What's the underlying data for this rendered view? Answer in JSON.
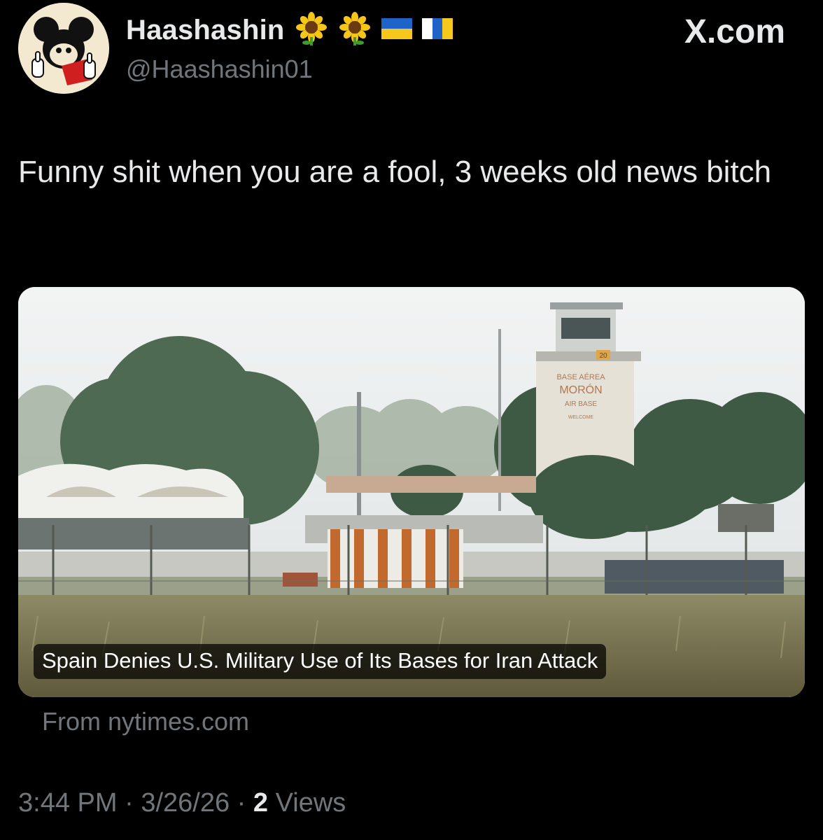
{
  "author": {
    "display_name": "Haashashin",
    "handle": "@Haashashin01",
    "badges": [
      "sunflower-emoji",
      "sunflower-emoji",
      "ukraine-flag",
      "canary-islands-flag"
    ]
  },
  "site_label": "X.com",
  "tweet": {
    "text": "Funny shit when you are a fool, 3 weeks old news bitch"
  },
  "link_card": {
    "headline": "Spain Denies U.S. Military Use of Its Bases for Iran Attack",
    "source": "From nytimes.com",
    "image_text": {
      "line1": "BASE AÉREA",
      "line2": "MORÓN",
      "line3": "AIR BASE",
      "line4": "WELCOME",
      "tower_number": "20"
    }
  },
  "footer": {
    "time": "3:44 PM",
    "separator": "·",
    "date": "3/26/26",
    "views_count": "2",
    "views_label": "Views"
  },
  "colors": {
    "background": "#000000",
    "primary_text": "#e7e9ea",
    "secondary_text": "#71767b"
  }
}
